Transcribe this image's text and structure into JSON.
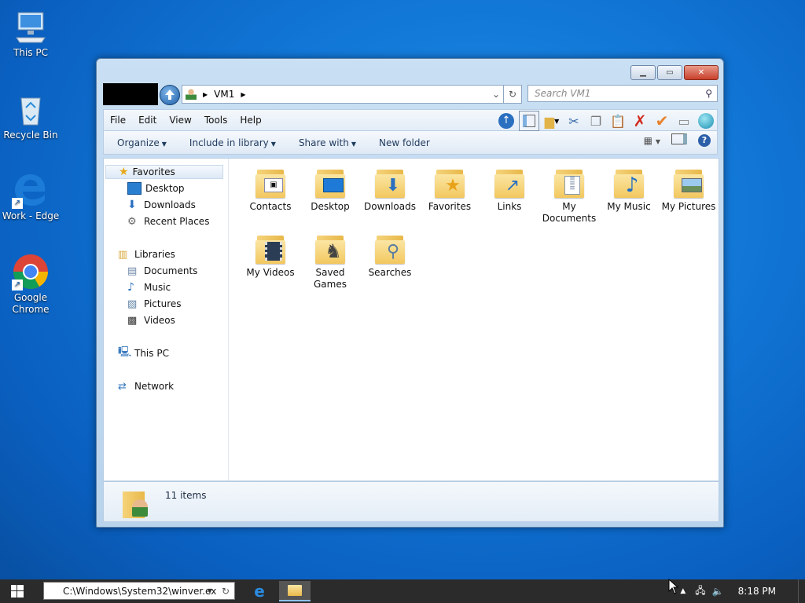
{
  "desktop": {
    "icons": [
      {
        "label": "This PC"
      },
      {
        "label": "Recycle Bin"
      },
      {
        "label": "Work - Edge"
      },
      {
        "label": "Google Chrome"
      }
    ]
  },
  "window": {
    "address_path": "VM1",
    "search_placeholder": "Search VM1",
    "menu": [
      "File",
      "Edit",
      "View",
      "Tools",
      "Help"
    ],
    "commands": [
      "Organize",
      "Include in library",
      "Share with",
      "New folder"
    ],
    "nav": {
      "favorites": {
        "label": "Favorites",
        "items": [
          "Desktop",
          "Downloads",
          "Recent Places"
        ]
      },
      "libraries": {
        "label": "Libraries",
        "items": [
          "Documents",
          "Music",
          "Pictures",
          "Videos"
        ]
      },
      "this_pc": "This PC",
      "network": "Network"
    },
    "files": [
      {
        "name": "Contacts",
        "icon": "contacts-icon"
      },
      {
        "name": "Desktop",
        "icon": "desktop-icon"
      },
      {
        "name": "Downloads",
        "icon": "download-arrow-icon"
      },
      {
        "name": "Favorites",
        "icon": "star-icon"
      },
      {
        "name": "Links",
        "icon": "link-arrow-icon"
      },
      {
        "name": "My Documents",
        "icon": "document-icon"
      },
      {
        "name": "My Music",
        "icon": "music-note-icon"
      },
      {
        "name": "My Pictures",
        "icon": "picture-icon"
      },
      {
        "name": "My Videos",
        "icon": "film-icon"
      },
      {
        "name": "Saved Games",
        "icon": "chess-piece-icon"
      },
      {
        "name": "Searches",
        "icon": "magnifier-icon"
      }
    ],
    "details": {
      "count": "11 items"
    }
  },
  "taskbar": {
    "address": "C:\\Windows\\System32\\winver.ex",
    "time": "8:18 PM"
  },
  "colors": {
    "accent": "#1176d6",
    "taskbar": "#2b2b2b"
  }
}
